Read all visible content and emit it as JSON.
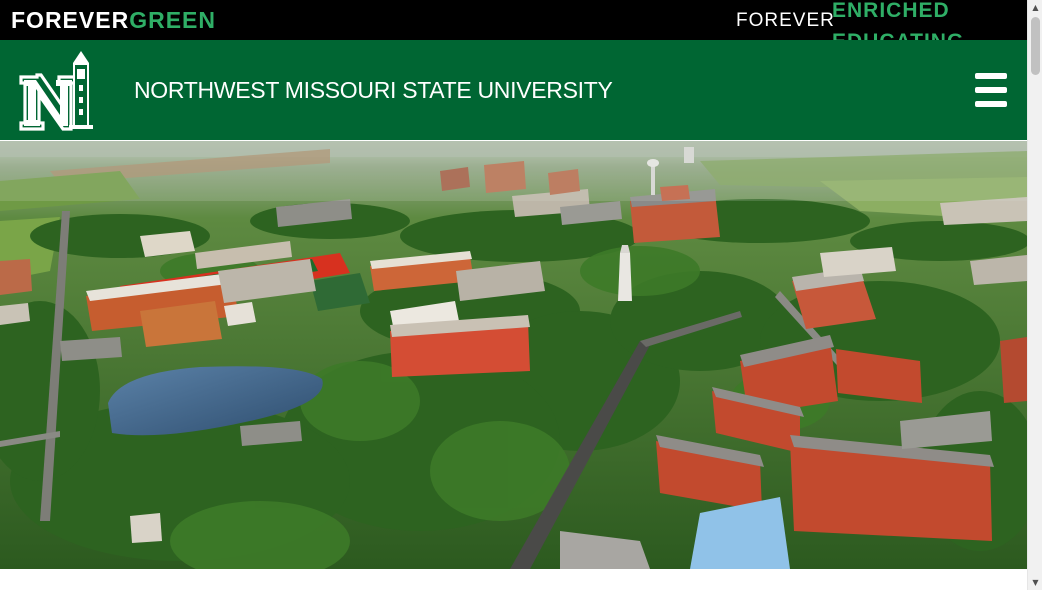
{
  "top_bar": {
    "campaign_word1": "FOREVER",
    "campaign_word2": "GREEN",
    "tagline_prefix": "FOREVER",
    "tagline_words": [
      "ENRICHED",
      "EDUCATING"
    ],
    "accent_color": "#2fae66"
  },
  "header": {
    "university_name": "NORTHWEST MISSOURI STATE UNIVERSITY",
    "logo_icon": "northwest-n-bell-tower-logo",
    "menu_icon": "hamburger-menu-icon",
    "background_color": "#006633"
  },
  "hero": {
    "image_description_icon": "campus-aerial-photo"
  },
  "scrollbar": {
    "up_arrow": "▲",
    "down_arrow": "▼"
  }
}
